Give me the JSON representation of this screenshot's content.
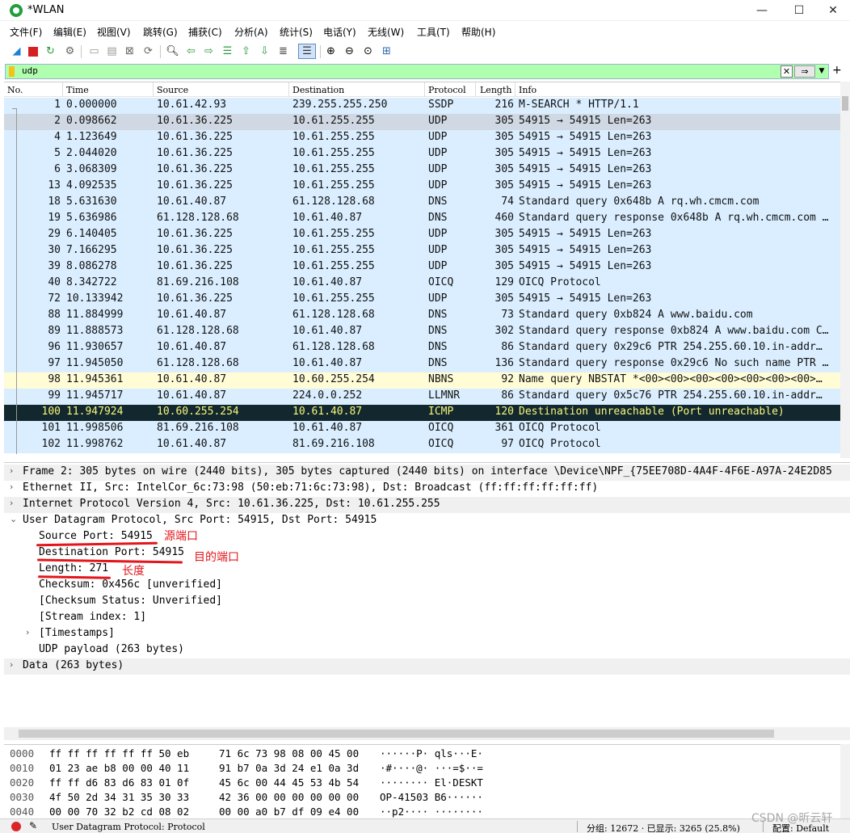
{
  "window": {
    "title": "*WLAN",
    "controls": [
      "—",
      "☐",
      "✕"
    ]
  },
  "menu": [
    "文件(F)",
    "编辑(E)",
    "视图(V)",
    "跳转(G)",
    "捕获(C)",
    "分析(A)",
    "统计(S)",
    "电话(Y)",
    "无线(W)",
    "工具(T)",
    "帮助(H)"
  ],
  "toolbar_icons": [
    "shark-fin-icon",
    "stop-icon",
    "restart-icon",
    "options-icon",
    "open-icon",
    "save-icon",
    "close-file-icon",
    "reload-icon",
    "find-icon",
    "back-icon",
    "forward-icon",
    "goto-icon",
    "first-icon",
    "last-icon",
    "autoscroll-icon",
    "colorize-icon",
    "zoom-in-icon",
    "zoom-out-icon",
    "zoom-reset-icon",
    "resize-columns-icon"
  ],
  "filter": {
    "value": "udp",
    "apply_label": "⇒",
    "clear_label": "✕"
  },
  "columns": [
    "No.",
    "Time",
    "Source",
    "Destination",
    "Protocol",
    "Length",
    "Info"
  ],
  "packets": [
    {
      "no": "1",
      "time": "0.000000",
      "src": "10.61.42.93",
      "dst": "239.255.255.250",
      "proto": "SSDP",
      "len": "216",
      "info": "M-SEARCH * HTTP/1.1",
      "style": ""
    },
    {
      "no": "2",
      "time": "0.098662",
      "src": "10.61.36.225",
      "dst": "10.61.255.255",
      "proto": "UDP",
      "len": "305",
      "info": "54915 → 54915 Len=263",
      "style": "sel"
    },
    {
      "no": "4",
      "time": "1.123649",
      "src": "10.61.36.225",
      "dst": "10.61.255.255",
      "proto": "UDP",
      "len": "305",
      "info": "54915 → 54915 Len=263",
      "style": ""
    },
    {
      "no": "5",
      "time": "2.044020",
      "src": "10.61.36.225",
      "dst": "10.61.255.255",
      "proto": "UDP",
      "len": "305",
      "info": "54915 → 54915 Len=263",
      "style": ""
    },
    {
      "no": "6",
      "time": "3.068309",
      "src": "10.61.36.225",
      "dst": "10.61.255.255",
      "proto": "UDP",
      "len": "305",
      "info": "54915 → 54915 Len=263",
      "style": ""
    },
    {
      "no": "13",
      "time": "4.092535",
      "src": "10.61.36.225",
      "dst": "10.61.255.255",
      "proto": "UDP",
      "len": "305",
      "info": "54915 → 54915 Len=263",
      "style": ""
    },
    {
      "no": "18",
      "time": "5.631630",
      "src": "10.61.40.87",
      "dst": "61.128.128.68",
      "proto": "DNS",
      "len": "74",
      "info": "Standard query 0x648b A rq.wh.cmcm.com",
      "style": ""
    },
    {
      "no": "19",
      "time": "5.636986",
      "src": "61.128.128.68",
      "dst": "10.61.40.87",
      "proto": "DNS",
      "len": "460",
      "info": "Standard query response 0x648b A rq.wh.cmcm.com …",
      "style": ""
    },
    {
      "no": "29",
      "time": "6.140405",
      "src": "10.61.36.225",
      "dst": "10.61.255.255",
      "proto": "UDP",
      "len": "305",
      "info": "54915 → 54915 Len=263",
      "style": ""
    },
    {
      "no": "30",
      "time": "7.166295",
      "src": "10.61.36.225",
      "dst": "10.61.255.255",
      "proto": "UDP",
      "len": "305",
      "info": "54915 → 54915 Len=263",
      "style": ""
    },
    {
      "no": "39",
      "time": "8.086278",
      "src": "10.61.36.225",
      "dst": "10.61.255.255",
      "proto": "UDP",
      "len": "305",
      "info": "54915 → 54915 Len=263",
      "style": ""
    },
    {
      "no": "40",
      "time": "8.342722",
      "src": "81.69.216.108",
      "dst": "10.61.40.87",
      "proto": "OICQ",
      "len": "129",
      "info": "OICQ Protocol",
      "style": ""
    },
    {
      "no": "72",
      "time": "10.133942",
      "src": "10.61.36.225",
      "dst": "10.61.255.255",
      "proto": "UDP",
      "len": "305",
      "info": "54915 → 54915 Len=263",
      "style": ""
    },
    {
      "no": "88",
      "time": "11.884999",
      "src": "10.61.40.87",
      "dst": "61.128.128.68",
      "proto": "DNS",
      "len": "73",
      "info": "Standard query 0xb824 A www.baidu.com",
      "style": ""
    },
    {
      "no": "89",
      "time": "11.888573",
      "src": "61.128.128.68",
      "dst": "10.61.40.87",
      "proto": "DNS",
      "len": "302",
      "info": "Standard query response 0xb824 A www.baidu.com C…",
      "style": ""
    },
    {
      "no": "96",
      "time": "11.930657",
      "src": "10.61.40.87",
      "dst": "61.128.128.68",
      "proto": "DNS",
      "len": "86",
      "info": "Standard query 0x29c6 PTR 254.255.60.10.in-addr…",
      "style": ""
    },
    {
      "no": "97",
      "time": "11.945050",
      "src": "61.128.128.68",
      "dst": "10.61.40.87",
      "proto": "DNS",
      "len": "136",
      "info": "Standard query response 0x29c6 No such name PTR …",
      "style": ""
    },
    {
      "no": "98",
      "time": "11.945361",
      "src": "10.61.40.87",
      "dst": "10.60.255.254",
      "proto": "NBNS",
      "len": "92",
      "info": "Name query NBSTAT *<00><00><00><00><00><00><00>…",
      "style": "nbns"
    },
    {
      "no": "99",
      "time": "11.945717",
      "src": "10.61.40.87",
      "dst": "224.0.0.252",
      "proto": "LLMNR",
      "len": "86",
      "info": "Standard query 0x5c76 PTR 254.255.60.10.in-addr…",
      "style": ""
    },
    {
      "no": "100",
      "time": "11.947924",
      "src": "10.60.255.254",
      "dst": "10.61.40.87",
      "proto": "ICMP",
      "len": "120",
      "info": "Destination unreachable (Port unreachable)",
      "style": "icmp"
    },
    {
      "no": "101",
      "time": "11.998506",
      "src": "81.69.216.108",
      "dst": "10.61.40.87",
      "proto": "OICQ",
      "len": "361",
      "info": "OICQ Protocol",
      "style": ""
    },
    {
      "no": "102",
      "time": "11.998762",
      "src": "10.61.40.87",
      "dst": "81.69.216.108",
      "proto": "OICQ",
      "len": "97",
      "info": "OICQ Protocol",
      "style": ""
    }
  ],
  "details": [
    {
      "text": "Frame 2: 305 bytes on wire (2440 bits), 305 bytes captured (2440 bits) on interface \\Device\\NPF_{75EE708D-4A4F-4F6E-A97A-24E2D85",
      "caret": "›",
      "indent": 0,
      "shade": true
    },
    {
      "text": "Ethernet II, Src: IntelCor_6c:73:98 (50:eb:71:6c:73:98), Dst: Broadcast (ff:ff:ff:ff:ff:ff)",
      "caret": "›",
      "indent": 0,
      "shade": false
    },
    {
      "text": "Internet Protocol Version 4, Src: 10.61.36.225, Dst: 10.61.255.255",
      "caret": "›",
      "indent": 0,
      "shade": true
    },
    {
      "text": "User Datagram Protocol, Src Port: 54915, Dst Port: 54915",
      "caret": "⌄",
      "indent": 0,
      "shade": false
    },
    {
      "text": "Source Port: 54915",
      "caret": "",
      "indent": 1,
      "shade": false
    },
    {
      "text": "Destination Port: 54915",
      "caret": "",
      "indent": 1,
      "shade": false
    },
    {
      "text": "Length: 271",
      "caret": "",
      "indent": 1,
      "shade": false
    },
    {
      "text": "Checksum: 0x456c [unverified]",
      "caret": "",
      "indent": 1,
      "shade": false
    },
    {
      "text": "[Checksum Status: Unverified]",
      "caret": "",
      "indent": 1,
      "shade": false
    },
    {
      "text": "[Stream index: 1]",
      "caret": "",
      "indent": 1,
      "shade": false
    },
    {
      "text": "[Timestamps]",
      "caret": "›",
      "indent": 1,
      "shade": false
    },
    {
      "text": "UDP payload (263 bytes)",
      "caret": "",
      "indent": 1,
      "shade": false
    },
    {
      "text": "Data (263 bytes)",
      "caret": "›",
      "indent": 0,
      "shade": true
    }
  ],
  "annotations": {
    "source_port": "源端口",
    "dest_port": "目的端口",
    "length": "长度"
  },
  "bytes": [
    {
      "off": "0000",
      "hex1": "ff ff ff ff ff ff 50 eb",
      "hex2": "71 6c 73 98 08 00 45 00",
      "asc": "······P· qls···E·"
    },
    {
      "off": "0010",
      "hex1": "01 23 ae b8 00 00 40 11",
      "hex2": "91 b7 0a 3d 24 e1 0a 3d",
      "asc": "·#····@· ···=$··="
    },
    {
      "off": "0020",
      "hex1": "ff ff d6 83 d6 83 01 0f",
      "hex2": "45 6c 00 44 45 53 4b 54",
      "asc": "········ El·DESKT"
    },
    {
      "off": "0030",
      "hex1": "4f 50 2d 34 31 35 30 33",
      "hex2": "42 36 00 00 00 00 00 00",
      "asc": "OP-41503 B6······"
    },
    {
      "off": "0040",
      "hex1": "00 00 70 32 b2 cd 08 02",
      "hex2": "00 00 a0 b7 df 09 e4 00",
      "asc": "··p2···· ········"
    }
  ],
  "status": {
    "field": "User Datagram Protocol: Protocol",
    "packets": "分组: 12672 · 已显示: 3265 (25.8%)",
    "profile": "配置: Default"
  },
  "watermark": "CSDN @昕云轩"
}
